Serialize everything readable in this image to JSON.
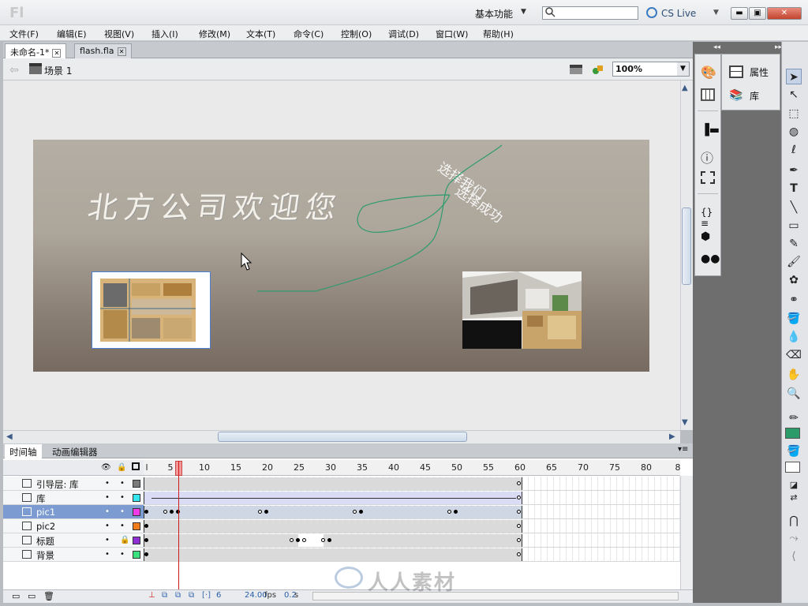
{
  "app": {
    "logo": "Fl",
    "workspace": "基本功能",
    "search_placeholder": "",
    "cslive": "CS Live"
  },
  "menu": [
    "文件(F)",
    "编辑(E)",
    "视图(V)",
    "插入(I)",
    "修改(M)",
    "文本(T)",
    "命令(C)",
    "控制(O)",
    "调试(D)",
    "窗口(W)",
    "帮助(H)"
  ],
  "doc_tabs": [
    "未命名-1*",
    "flash.fla"
  ],
  "editbar": {
    "scene": "场景 1",
    "zoom": "100%"
  },
  "stage": {
    "welcome": "北方公司欢迎您",
    "choose": "选择我们",
    "success": "选择成功",
    "motion_path_color": "#2f9b6f"
  },
  "timeline": {
    "tabs": [
      "时间轴",
      "动画编辑器"
    ],
    "ruler": [
      "l",
      "5",
      "10",
      "15",
      "20",
      "25",
      "30",
      "35",
      "40",
      "45",
      "50",
      "55",
      "60",
      "65",
      "70",
      "75",
      "80",
      "8"
    ],
    "layers": [
      {
        "name": "引导层: 库",
        "color": "#7a7a7a"
      },
      {
        "name": "库",
        "color": "#35e6ef"
      },
      {
        "name": "pic1",
        "color": "#f03be8"
      },
      {
        "name": "pic2",
        "color": "#f07c1c"
      },
      {
        "name": "标题",
        "color": "#8e2fd6"
      },
      {
        "name": "背景",
        "color": "#3ce07c"
      }
    ],
    "current_frame": "6",
    "fps": "24.00",
    "fps_unit": "fps",
    "time": "0.2",
    "time_unit": "s"
  },
  "panels": {
    "properties": "属性",
    "library": "库"
  },
  "watermark": "人人素材"
}
